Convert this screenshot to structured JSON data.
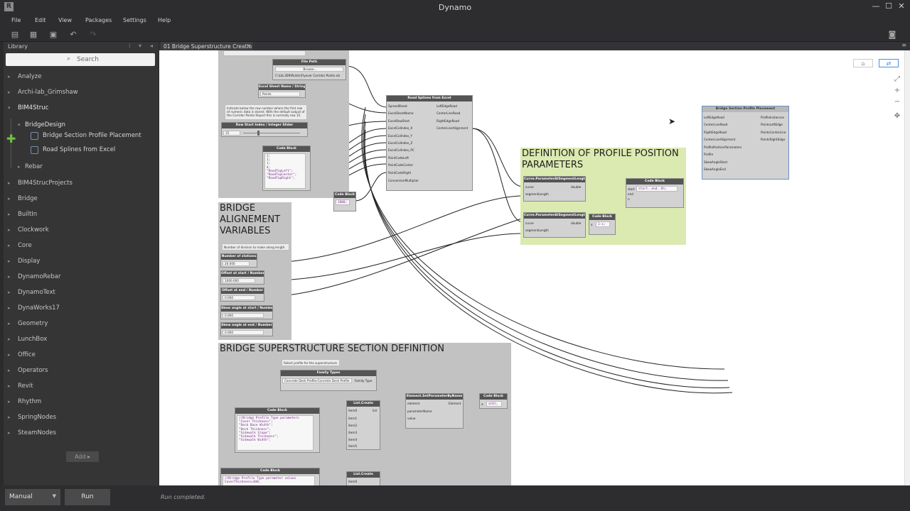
{
  "window": {
    "app_icon": "R",
    "title": "Dynamo",
    "controls": {
      "minimize": "—",
      "maximize": "☐",
      "close": "✕"
    }
  },
  "menu": [
    "File",
    "Edit",
    "View",
    "Packages",
    "Settings",
    "Help"
  ],
  "toolbar": {
    "icons": [
      "new-file-icon",
      "open-icon",
      "save-icon",
      "undo-icon",
      "redo-icon"
    ],
    "camera_icon": "camera-icon"
  },
  "library": {
    "header": "Library",
    "search_placeholder": "Search",
    "items": [
      {
        "label": "Analyze"
      },
      {
        "label": "Archi-lab_Grimshaw"
      },
      {
        "label": "BIM4Struc"
      },
      {
        "label": "BridgeDesign"
      },
      {
        "label": "Bridge Section Profile Placement"
      },
      {
        "label": "Road Splines from Excel"
      },
      {
        "label": "Rebar"
      },
      {
        "label": "BIM4StrucProjects"
      },
      {
        "label": "Bridge"
      },
      {
        "label": "BuiltIn"
      },
      {
        "label": "Clockwork"
      },
      {
        "label": "Core"
      },
      {
        "label": "Display"
      },
      {
        "label": "DynamoRebar"
      },
      {
        "label": "DynamoText"
      },
      {
        "label": "DynaWorks17"
      },
      {
        "label": "Geometry"
      },
      {
        "label": "LunchBox"
      },
      {
        "label": "Office"
      },
      {
        "label": "Operators"
      },
      {
        "label": "Revit"
      },
      {
        "label": "Rhythm"
      },
      {
        "label": "SpringNodes"
      },
      {
        "label": "SteamNodes"
      }
    ],
    "add_button": "Add"
  },
  "tab": {
    "label": "01 Bridge Superstructure Creatio"
  },
  "canvas": {
    "groups": {
      "profile_position": "DEFINITION OF PROFILE POSITION PARAMETERS",
      "alignment": "BRIDGE ALIGNEMENT VARIABLES",
      "section": "BRIDGE SUPERSTRUCTURE SECTION DEFINITION"
    },
    "nodes": {
      "file_path": {
        "title": "File Path",
        "button": "Browse...",
        "value": "C:\\Lib.309\\Points\\Flyover Corridor Points.xls"
      },
      "excel_sheet": {
        "title": "Excel Sheet Name / String",
        "value": "Points"
      },
      "row_note": "Indicate below the row number where the first row of numeric data is stored. With the default output of the Corridor Points Report this is normally row 15.",
      "row_slider": {
        "title": "Row Start Index / Integer Slider",
        "value": "15"
      },
      "code1": {
        "title": "Code Block",
        "code": "1;\n1;\n1;\n4;\n\"RoadTopLeft\";\n\"RoadTopCenter\";\n\"RoadTopRight\";"
      },
      "code2": {
        "title": "Code Block",
        "code": "1000;"
      },
      "road_splines": {
        "title": "Road Splines from Excel",
        "inputs": [
          "SpreadSheet",
          "ExcelSheetName",
          "ExcelRowStart",
          "ExcelColIndex_X",
          "ExcelColIndex_Y",
          "ExcelColIndex_Z",
          "ExcelColIndex_PC",
          "PointCodeLeft",
          "PointCodeCenter",
          "PointCodeRight",
          "ConversionMultiplier"
        ],
        "outputs": [
          "LeftEdgeRoad",
          "CenterLineRoad",
          "RightEdgeRoad",
          "CenterLineAlignment"
        ]
      },
      "param_seg1": {
        "title": "Curve.ParameterAtSegmentLength",
        "inputs": [
          "curve",
          "segmentLength"
        ],
        "output": "double"
      },
      "param_seg2": {
        "title": "Curve.ParameterAtSegmentLength",
        "inputs": [
          "curve",
          "segmentLength"
        ],
        "output": "double"
      },
      "code3": {
        "title": "Code Block",
        "code": "start..end..#n;",
        "ports": [
          "start",
          "end",
          "n"
        ]
      },
      "code4": {
        "title": "Code Block",
        "code": "1-x;",
        "port": "x"
      },
      "placement": {
        "title": "Bridge Section Profile Placement",
        "inputs": [
          "LeftEdgeRoad",
          "CenterLineRoad",
          "RightEdgeRoad",
          "CenterLineAlignment",
          "ProfilePositionParameters",
          "Profile",
          "SkewAngleStart",
          "SkewAngleEnd"
        ],
        "outputs": [
          "ProfileInstances",
          "PointsLeftEdge",
          "PointsCenterLine",
          "PointsRightEdge"
        ]
      },
      "alignment_note": "Number of division to make along length",
      "stations": {
        "title": "Number of stations",
        "value": "20.000"
      },
      "offset_start": {
        "title": "Offset at start / Number",
        "value": "1000.000"
      },
      "offset_end": {
        "title": "Offset at end / Number",
        "value": "0.000"
      },
      "skew_start": {
        "title": "Skew angle at start / Number",
        "value": "0.000"
      },
      "skew_end": {
        "title": "Skew angle at end / Number",
        "value": "0.000"
      },
      "profile_note": "Select profile for the superstructure",
      "family_types": {
        "title": "Family Types",
        "value": "Concrete Deck Profile:Concrete Deck Profile",
        "output": "Family Type"
      },
      "code5": {
        "title": "Code Block",
        "code": "//Bridge Profile Type parameters\n\"Cover Thickness\";\n\"Deck Base Width\";\n\"Deck Thickness\";\n\"Sidewalk Slope\";\n\"Sidewalk Thickness\";\n\"Sidewalk Width\";"
      },
      "list_create1": {
        "title": "List.Create",
        "inputs": [
          "item0",
          "item1",
          "item2",
          "item3",
          "item4",
          "item5"
        ],
        "output": "list"
      },
      "set_param": {
        "title": "Element.SetParameterByName",
        "inputs": [
          "element",
          "parameterName",
          "value"
        ],
        "output": "Element"
      },
      "code6": {
        "title": "Code Block",
        "code": "a[0];",
        "port": "a"
      },
      "code7": {
        "title": "Code Block",
        "code": "//Bridge Profile Type parameter values\nCoverThickness=100;"
      },
      "list_create2": {
        "title": "List.Create",
        "inputs": [
          "item0"
        ]
      }
    }
  },
  "bottom": {
    "run_mode": "Manual",
    "run_button": "Run",
    "status": "Run completed."
  },
  "colors": {
    "chrome": "#2d2d30",
    "library": "#353535",
    "group_gray": "#bfbfbf",
    "group_green": "#dbeab0",
    "node_header": "#545454",
    "accent_green": "#6ec046"
  }
}
